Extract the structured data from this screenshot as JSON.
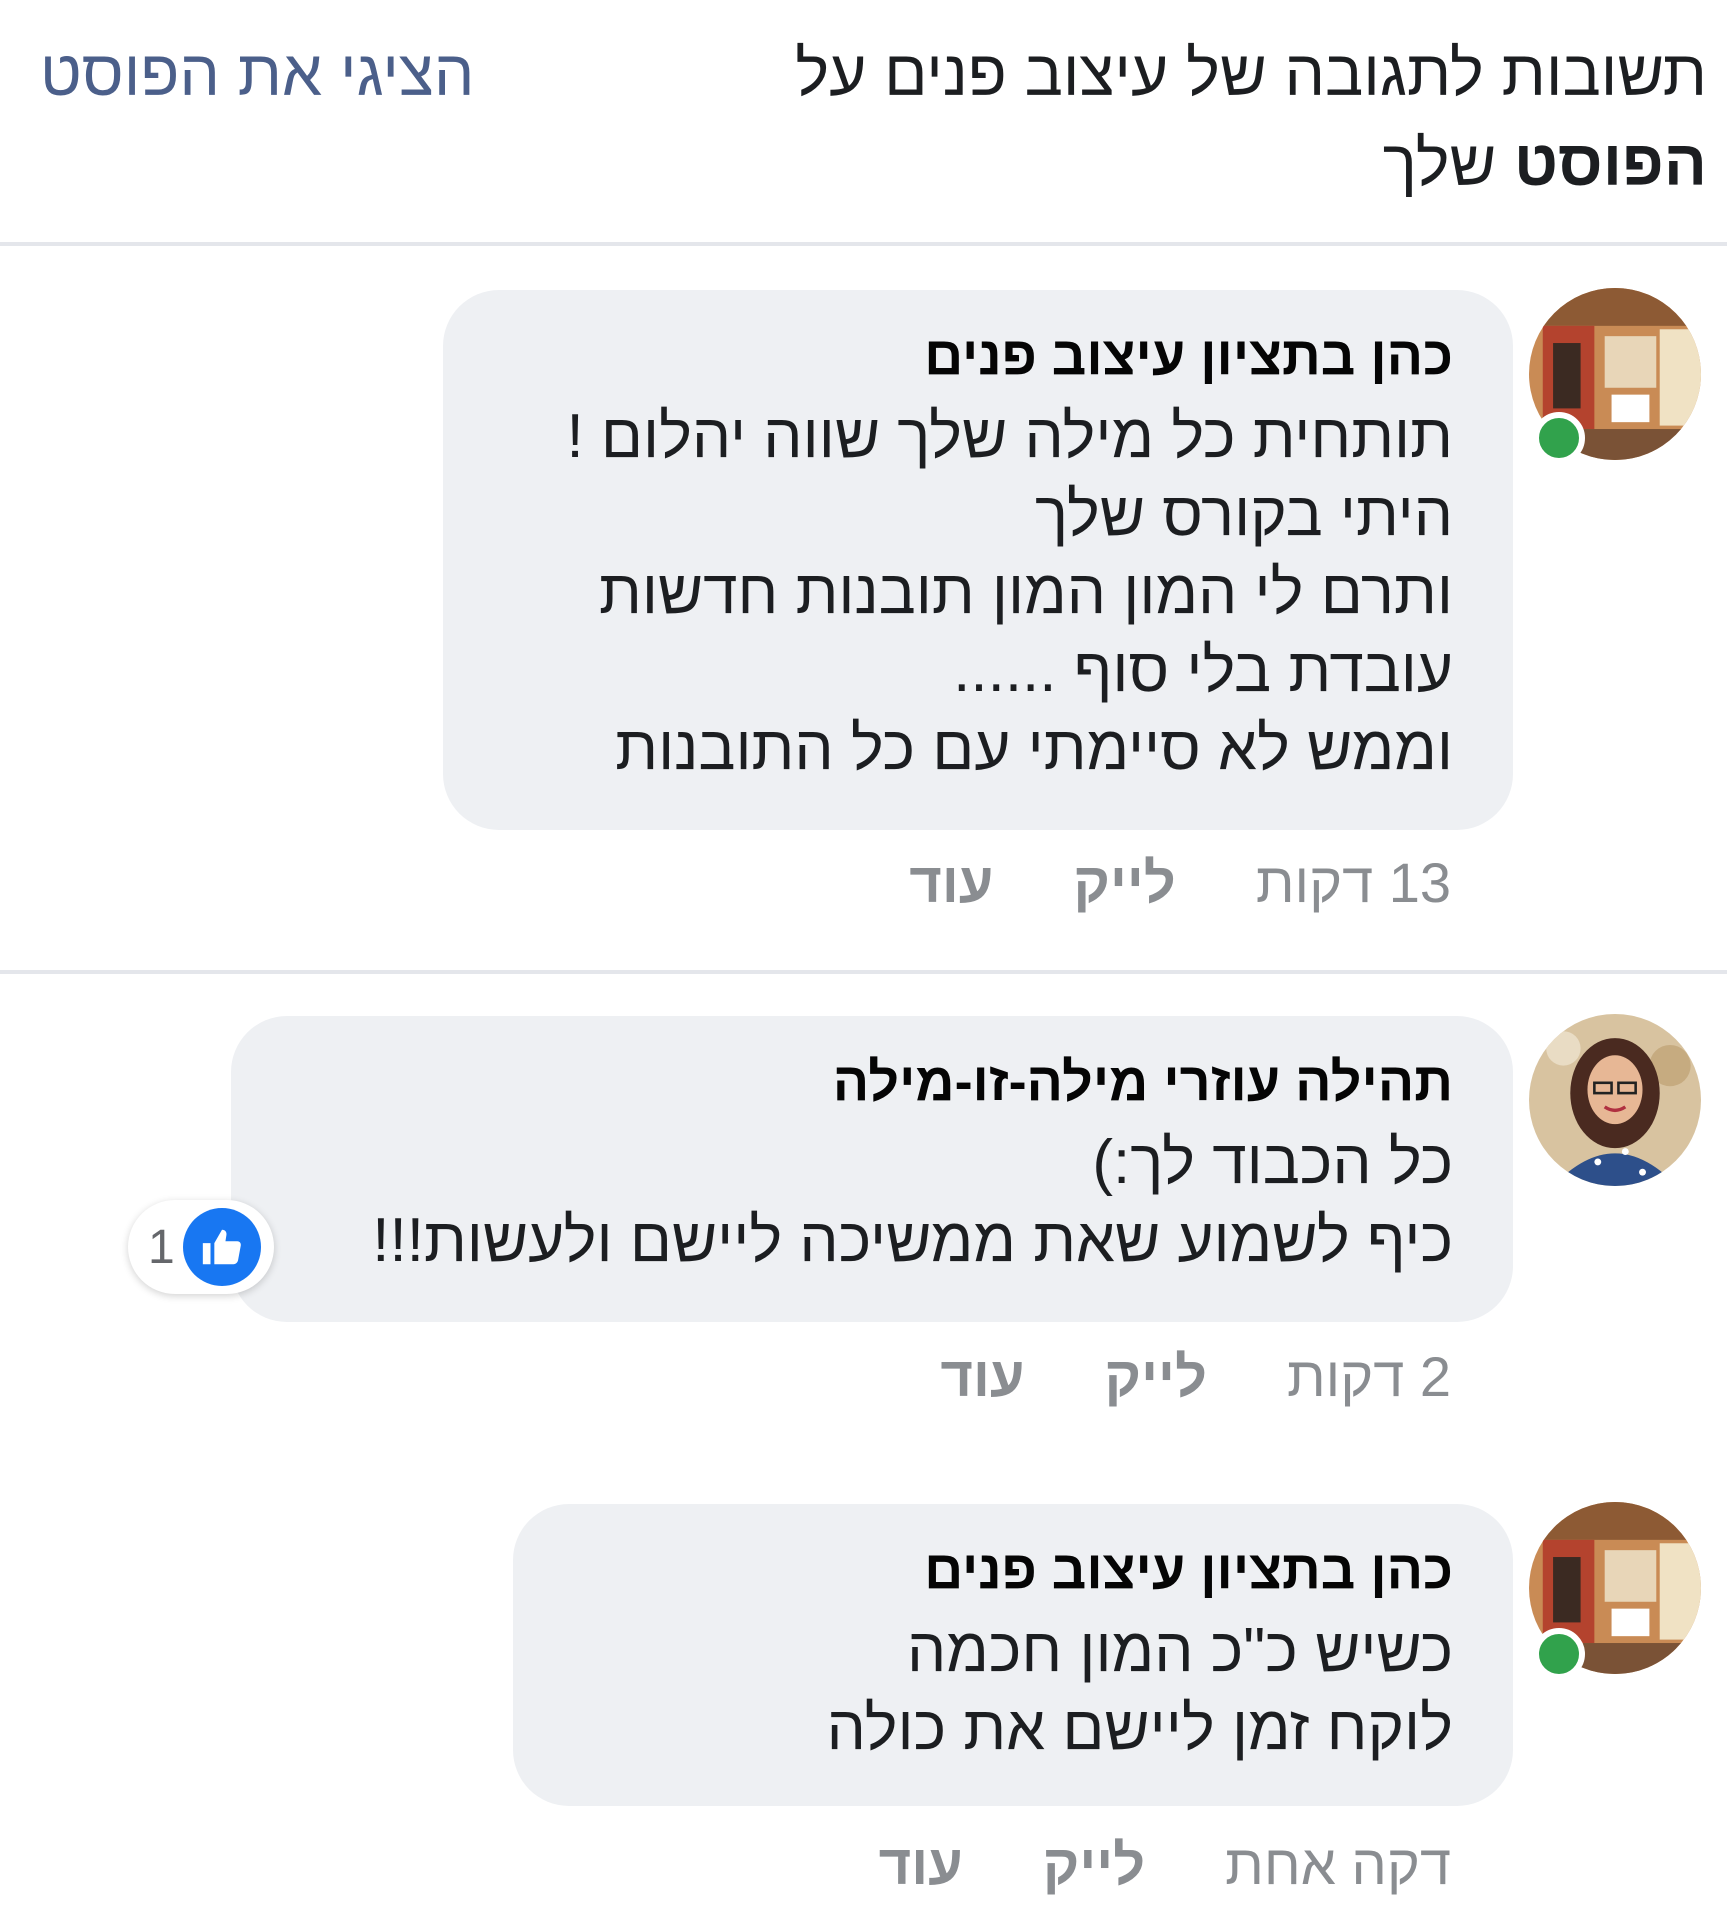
{
  "header": {
    "title_line1": "תשובות לתגובה של עיצוב פנים על",
    "title_bold": "הפוסט",
    "title_rest": " שלך",
    "show_post_link": "הציגי את הפוסט"
  },
  "comments": [
    {
      "author": "כהן בתציון עיצוב פנים",
      "online": true,
      "lines": [
        "תותחית כל מילה שלך שווה יהלום !",
        "היתי בקורס שלך",
        "ותרם לי המון המון תובנות חדשות",
        "עובדת בלי סוף ......",
        "וממש לא סיימתי עם כל התובנות"
      ],
      "time": "13 דקות",
      "like_label": "לייק",
      "more_label": "עוד"
    },
    {
      "author": "תהילה עוזרי מילה-זו-מילה",
      "online": false,
      "lines": [
        "כל הכבוד לך:)",
        "כיף לשמוע שאת ממשיכה ליישם ולעשות!!!"
      ],
      "reaction_count": "1",
      "time": "2 דקות",
      "like_label": "לייק",
      "more_label": "עוד"
    },
    {
      "author": "כהן בתציון עיצוב פנים",
      "online": true,
      "lines": [
        "כשיש כ\"כ המון חכמה",
        "לוקח זמן ליישם את כולה"
      ],
      "time": "דקה אחת",
      "like_label": "לייק",
      "more_label": "עוד"
    }
  ],
  "icons": {
    "online_indicator": "online-dot",
    "reaction": "thumbs-up-icon"
  },
  "colors": {
    "bubble": "#eef0f3",
    "link": "#4b5f8a",
    "online": "#31a24c",
    "like_blue": "#1877f2",
    "meta_gray": "#8a8d91"
  }
}
